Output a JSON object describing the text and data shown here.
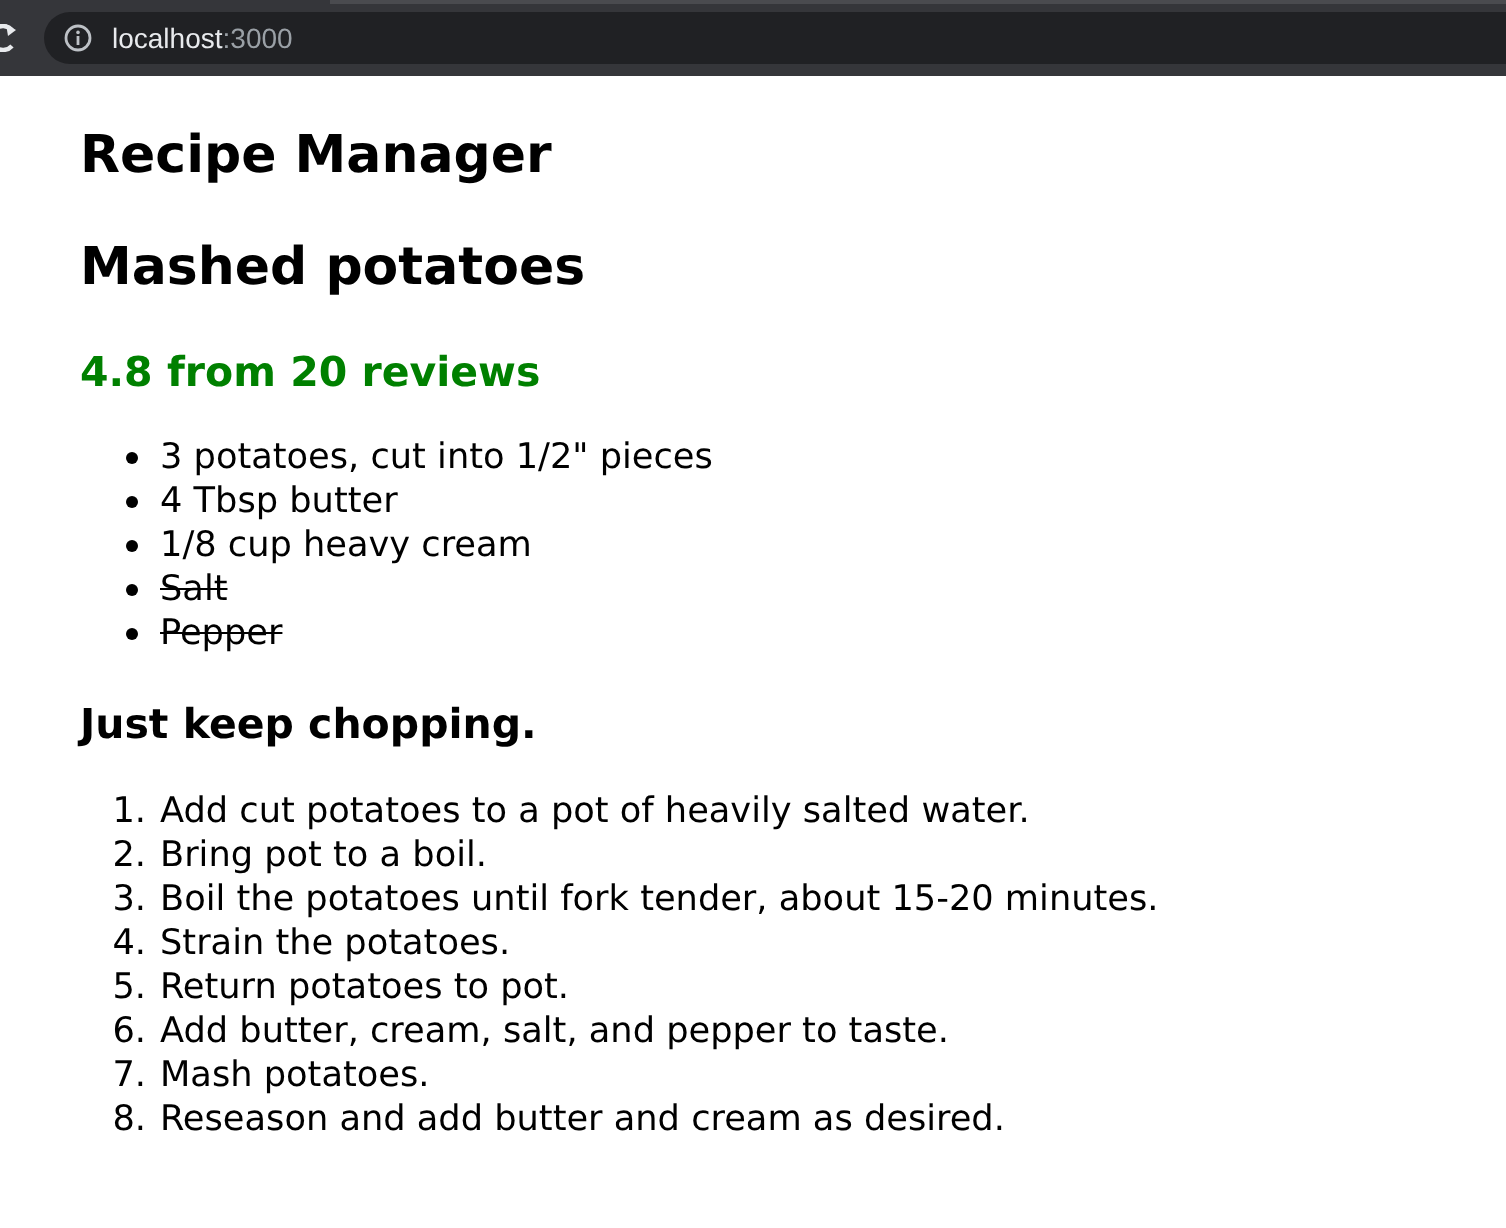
{
  "browser": {
    "url_host": "localhost",
    "url_port": ":3000"
  },
  "app_title": "Recipe Manager",
  "recipe": {
    "name": "Mashed potatoes",
    "rating": "4.8 from 20 reviews",
    "ingredients": [
      {
        "text": "3 potatoes, cut into 1/2\" pieces",
        "crossed_out": false
      },
      {
        "text": "4 Tbsp butter",
        "crossed_out": false
      },
      {
        "text": "1/8 cup heavy cream",
        "crossed_out": false
      },
      {
        "text": "Salt",
        "crossed_out": true
      },
      {
        "text": "Pepper",
        "crossed_out": true
      }
    ],
    "steps_heading": "Just keep chopping.",
    "steps": [
      {
        "number": "1.",
        "text": "Add cut potatoes to a pot of heavily salted water."
      },
      {
        "number": "2.",
        "text": "Bring pot to a boil."
      },
      {
        "number": "3.",
        "text": "Boil the potatoes until fork tender, about 15-20 minutes."
      },
      {
        "number": "4.",
        "text": "Strain the potatoes."
      },
      {
        "number": "5.",
        "text": "Return potatoes to pot."
      },
      {
        "number": "6.",
        "text": "Add butter, cream, salt, and pepper to taste."
      },
      {
        "number": "7.",
        "text": "Mash potatoes."
      },
      {
        "number": "8.",
        "text": "Reseason and add butter and cream as desired."
      }
    ]
  }
}
